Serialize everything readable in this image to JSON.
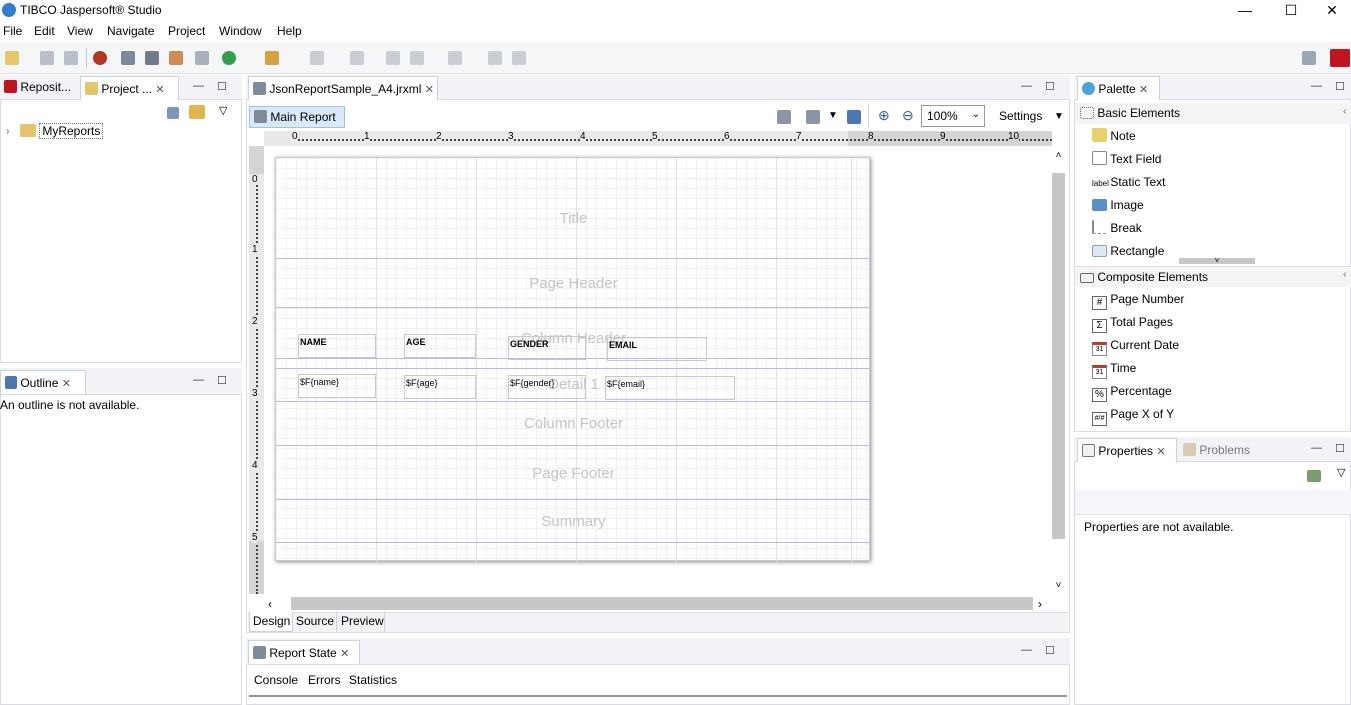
{
  "app": {
    "title": "TIBCO Jaspersoft® Studio"
  },
  "window_controls": {
    "minimize": "—",
    "maximize": "☐",
    "close": "✕"
  },
  "menu": [
    "File",
    "Edit",
    "View",
    "Navigate",
    "Project",
    "Window",
    "Help"
  ],
  "left": {
    "tabs": [
      "Reposit...",
      "Project ..."
    ],
    "tree_item": "MyReports",
    "outline_tab": "Outline",
    "outline_msg": "An outline is not available."
  },
  "editor": {
    "tab": "JsonReportSample_A4.jrxml",
    "main_report": "Main Report",
    "zoom": "100%",
    "settings": "Settings",
    "ruler_h": [
      "0",
      "1",
      "2",
      "3",
      "4",
      "5",
      "6",
      "7",
      "8",
      "9",
      "10"
    ],
    "ruler_v": [
      "0",
      "1",
      "2",
      "3",
      "4",
      "5"
    ],
    "bands": [
      "Title",
      "Page Header",
      "Column Header",
      "Detail 1",
      "Column Footer",
      "Page Footer",
      "Summary"
    ],
    "headers": [
      "NAME",
      "AGE",
      "GENDER",
      "EMAIL"
    ],
    "fields": [
      "$F{name}",
      "$F{age}",
      "$F{gender}",
      "$F{email}"
    ],
    "bottom_tabs": [
      "Design",
      "Source",
      "Preview"
    ]
  },
  "report_state": {
    "tab": "Report State",
    "tabs": [
      "Console",
      "Errors",
      "Statistics"
    ]
  },
  "palette": {
    "tab": "Palette",
    "basic_title": "Basic Elements",
    "basic": [
      "Note",
      "Text Field",
      "Static Text",
      "Image",
      "Break",
      "Rectangle"
    ],
    "composite_title": "Composite Elements",
    "composite": [
      "Page Number",
      "Total Pages",
      "Current Date",
      "Time",
      "Percentage",
      "Page X of Y"
    ],
    "icon_glyphs": {
      "label": "label",
      "hash": "#",
      "sigma": "Σ",
      "cal": "31",
      "pct": "%",
      "xy": "#/#"
    }
  },
  "properties": {
    "tab": "Properties",
    "problems_tab": "Problems",
    "msg": "Properties are not available."
  },
  "colors": {
    "accent": "#2f7fd0",
    "band_line": "#b8b8e6",
    "active_btn": "#d9e9fb",
    "red_icon": "#c0141e"
  }
}
